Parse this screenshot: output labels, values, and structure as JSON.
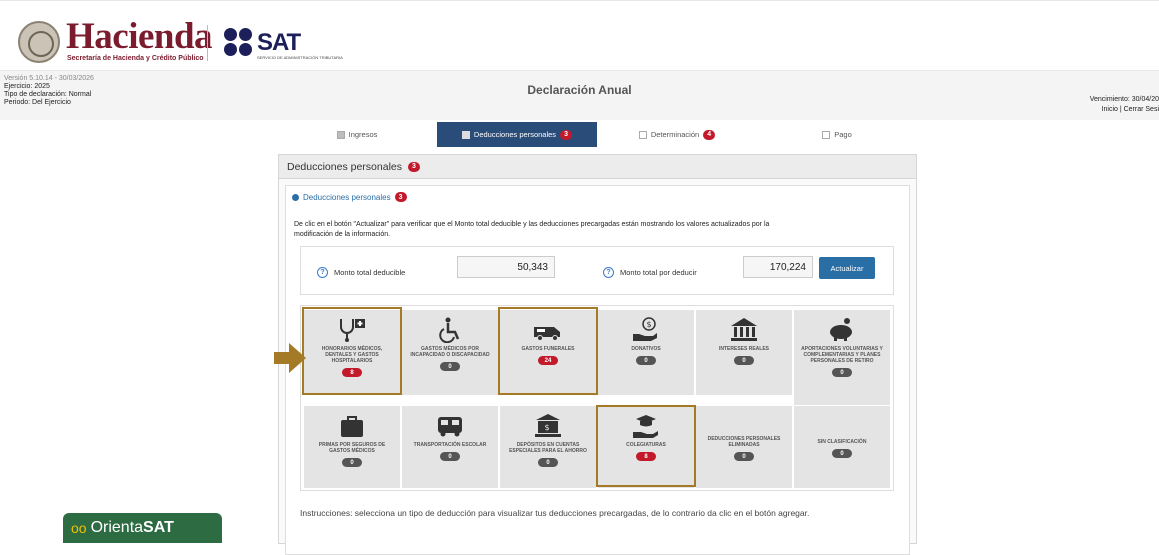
{
  "header": {
    "brand_name": "Hacienda",
    "brand_sub": "Secretaría de Hacienda y Crédito Público",
    "sat_logo_text": "SAT",
    "sat_sub": "SERVICIO DE ADMINISTRACIÓN TRIBUTARIA"
  },
  "info": {
    "version": "Versión 5.10.14 - 30/03/2026",
    "ejercicio": "Ejercicio: 2025",
    "tipo": "Tipo de declaración: Normal",
    "periodo": "Periodo: Del Ejercicio",
    "title": "Declaración Anual",
    "vencimiento": "Vencimiento: 30/04/20",
    "links": "Inicio | Cerrar Sesi"
  },
  "tabs": [
    {
      "label": "Ingresos",
      "badge": ""
    },
    {
      "label": "Deducciones personales",
      "badge": "3"
    },
    {
      "label": "Determinación",
      "badge": "4"
    },
    {
      "label": "Pago",
      "badge": ""
    }
  ],
  "panel": {
    "title": "Deducciones personales",
    "badge": "3",
    "accordion_label": "Deducciones personales",
    "accordion_badge": "3",
    "description": "De clic en el botón \"Actualizar\" para verificar que el Monto total deducible y las deducciones precargadas están mostrando los valores actualizados por la modificación de la información.",
    "monto_deducible_label": "Monto total deducible",
    "monto_deducible_value": "50,343",
    "monto_por_deducir_label": "Monto total por deducir",
    "monto_por_deducir_value": "170,224",
    "actualizar_label": "Actualizar",
    "instructions": "Instrucciones: selecciona un tipo de deducción para visualizar tus deducciones precargadas, de lo contrario da clic en el botón agregar."
  },
  "deductions": [
    {
      "label": "HONORARIOS MÉDICOS, DENTALES Y GASTOS HOSPITALARIOS",
      "count": "8",
      "icon": "medical-icon"
    },
    {
      "label": "GASTOS MÉDICOS POR INCAPACIDAD O DISCAPACIDAD",
      "count": "0",
      "icon": "wheelchair-icon"
    },
    {
      "label": "GASTOS FUNERALES",
      "count": "24",
      "icon": "hearse-icon"
    },
    {
      "label": "DONATIVOS",
      "count": "0",
      "icon": "donation-icon"
    },
    {
      "label": "INTERESES REALES",
      "count": "0",
      "icon": "bank-icon"
    },
    {
      "label": "APORTACIONES VOLUNTARIAS Y COMPLEMENTARIAS Y PLANES PERSONALES DE RETIRO",
      "count": "0",
      "icon": "piggy-bank-icon"
    },
    {
      "label": "PRIMAS POR SEGUROS DE GASTOS MÉDICOS",
      "count": "0",
      "icon": "medical-bag-icon"
    },
    {
      "label": "TRANSPORTACIÓN ESCOLAR",
      "count": "0",
      "icon": "school-bus-icon"
    },
    {
      "label": "DEPÓSITOS EN CUENTAS ESPECIALES PARA EL AHORRO",
      "count": "0",
      "icon": "savings-bank-icon"
    },
    {
      "label": "COLEGIATURAS",
      "count": "8",
      "icon": "graduation-icon"
    },
    {
      "label": "DEDUCCIONES PERSONALES ELIMINADAS",
      "count": "0",
      "icon": ""
    },
    {
      "label": "SIN CLASIFICACIÓN",
      "count": "0",
      "icon": ""
    }
  ],
  "orienta": {
    "prefix": "Orienta",
    "bold": "SAT"
  }
}
